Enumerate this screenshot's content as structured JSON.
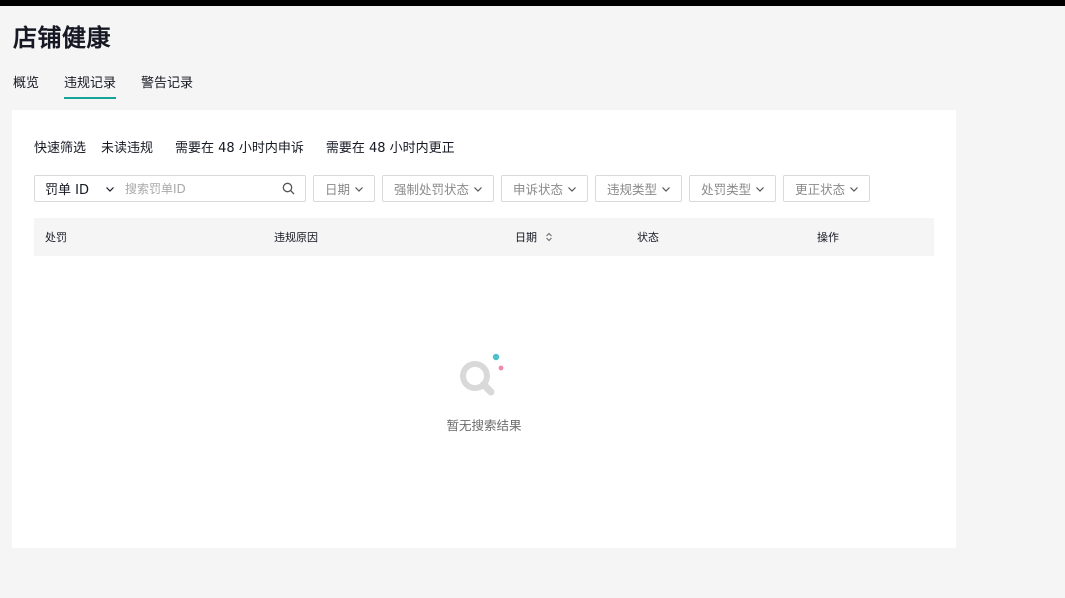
{
  "page": {
    "title": "店铺健康"
  },
  "tabs": [
    {
      "label": "概览",
      "active": false
    },
    {
      "label": "违规记录",
      "active": true
    },
    {
      "label": "警告记录",
      "active": false
    }
  ],
  "quick_filter": {
    "label": "快速筛选",
    "chips": [
      "未读违规",
      "需要在 48 小时内申诉",
      "需要在 48 小时内更正"
    ]
  },
  "search": {
    "type_selected": "罚单 ID",
    "placeholder": "搜索罚单ID",
    "icon": "search-icon"
  },
  "filters": [
    {
      "label": "日期"
    },
    {
      "label": "强制处罚状态"
    },
    {
      "label": "申诉状态"
    },
    {
      "label": "违规类型"
    },
    {
      "label": "处罚类型"
    },
    {
      "label": "更正状态"
    }
  ],
  "table": {
    "columns": [
      "处罚",
      "违规原因",
      "日期",
      "状态",
      "操作"
    ],
    "sortable_column": "日期"
  },
  "empty_state": {
    "text": "暂无搜索结果",
    "icon": "empty-search-icon"
  },
  "colors": {
    "accent": "#18a39a",
    "background": "#f5f5f5",
    "card": "#ffffff",
    "header_bar": "#000000"
  }
}
